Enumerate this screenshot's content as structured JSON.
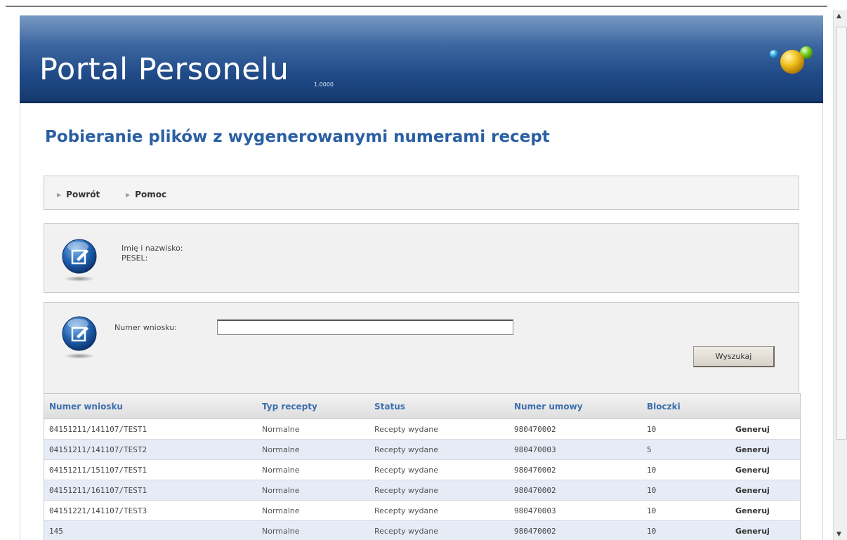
{
  "header": {
    "title": "Portal Personelu",
    "version": "1.0000"
  },
  "page_title": "Pobieranie plików z wygenerowanymi numerami recept",
  "nav": {
    "items": [
      {
        "label": "Powrót"
      },
      {
        "label": "Pomoc"
      }
    ]
  },
  "user_panel": {
    "name_label": "Imię i nazwisko:",
    "pesel_label": "PESEL:"
  },
  "search_panel": {
    "label": "Numer wniosku:",
    "value": "",
    "button_label": "Wyszukaj"
  },
  "table": {
    "headers": [
      "Numer wniosku",
      "Typ recepty",
      "Status",
      "Numer umowy",
      "Bloczki",
      ""
    ],
    "rows": [
      {
        "numer": "04151211/141107/TEST1",
        "typ": "Normalne",
        "status": "Recepty wydane",
        "umowa": "980470002",
        "bloczki": "10",
        "action": "Generuj"
      },
      {
        "numer": "04151211/141107/TEST2",
        "typ": "Normalne",
        "status": "Recepty wydane",
        "umowa": "980470003",
        "bloczki": "5",
        "action": "Generuj"
      },
      {
        "numer": "04151211/151107/TEST1",
        "typ": "Normalne",
        "status": "Recepty wydane",
        "umowa": "980470002",
        "bloczki": "10",
        "action": "Generuj"
      },
      {
        "numer": "04151211/161107/TEST1",
        "typ": "Normalne",
        "status": "Recepty wydane",
        "umowa": "980470002",
        "bloczki": "10",
        "action": "Generuj"
      },
      {
        "numer": "04151221/141107/TEST3",
        "typ": "Normalne",
        "status": "Recepty wydane",
        "umowa": "980470003",
        "bloczki": "10",
        "action": "Generuj"
      },
      {
        "numer": "145",
        "typ": "Normalne",
        "status": "Recepty wydane",
        "umowa": "980470002",
        "bloczki": "10",
        "action": "Generuj"
      }
    ]
  },
  "colors": {
    "header_blue": "#1f4a87",
    "title_blue": "#2a5fa3",
    "row_alt": "#e6ecf6"
  }
}
